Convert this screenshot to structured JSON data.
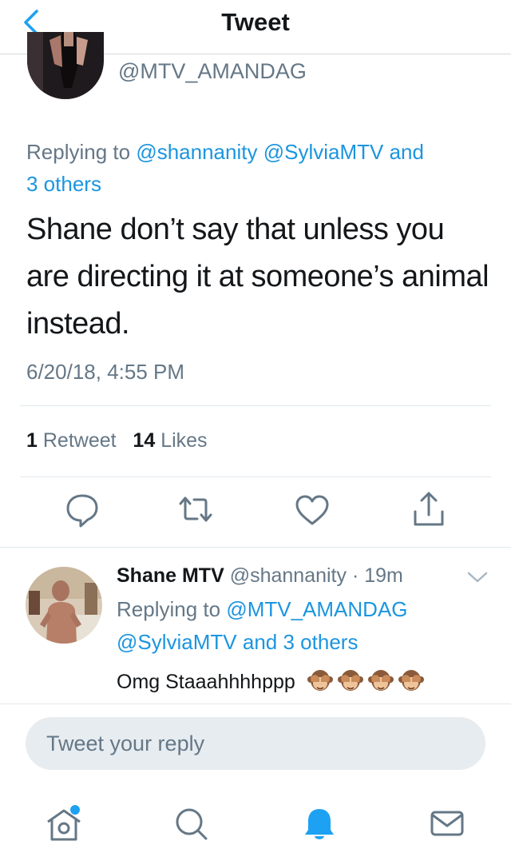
{
  "nav": {
    "title": "Tweet",
    "back_icon": "chevron-left-icon"
  },
  "tweet": {
    "handle": "@MTV_AMANDAG",
    "replying_prefix": "Replying to",
    "replying_to": [
      "@shannanity",
      "@SylviaMTV"
    ],
    "replying_and": "and",
    "replying_others": "3 others",
    "text": "Shane don’t say that unless you are directing it at someone’s animal instead.",
    "timestamp": "6/20/18, 4:55 PM",
    "stats": {
      "retweet_count": "1",
      "retweet_label": "Retweet",
      "like_count": "14",
      "like_label": "Likes"
    },
    "actions": [
      "reply-icon",
      "retweet-icon",
      "like-icon",
      "share-icon"
    ]
  },
  "reply": {
    "name": "Shane MTV",
    "handle": "@shannanity",
    "time": "· 19m",
    "replying_prefix": "Replying to",
    "replying_to": [
      "@MTV_AMANDAG",
      "@SylviaMTV"
    ],
    "replying_and": "and",
    "replying_others": "3 others",
    "text": "Omg Staaahhhhppp",
    "emoji_count": 4,
    "emoji_name": "see-no-evil-monkey-icon"
  },
  "compose": {
    "placeholder": "Tweet your reply"
  },
  "tabs": [
    "home-icon",
    "search-icon",
    "notifications-icon",
    "messages-icon"
  ],
  "colors": {
    "accent": "#1da1f2",
    "link": "#1b95e0",
    "muted": "#657786",
    "text": "#14171a",
    "compose_bg": "#e6ecf0"
  }
}
